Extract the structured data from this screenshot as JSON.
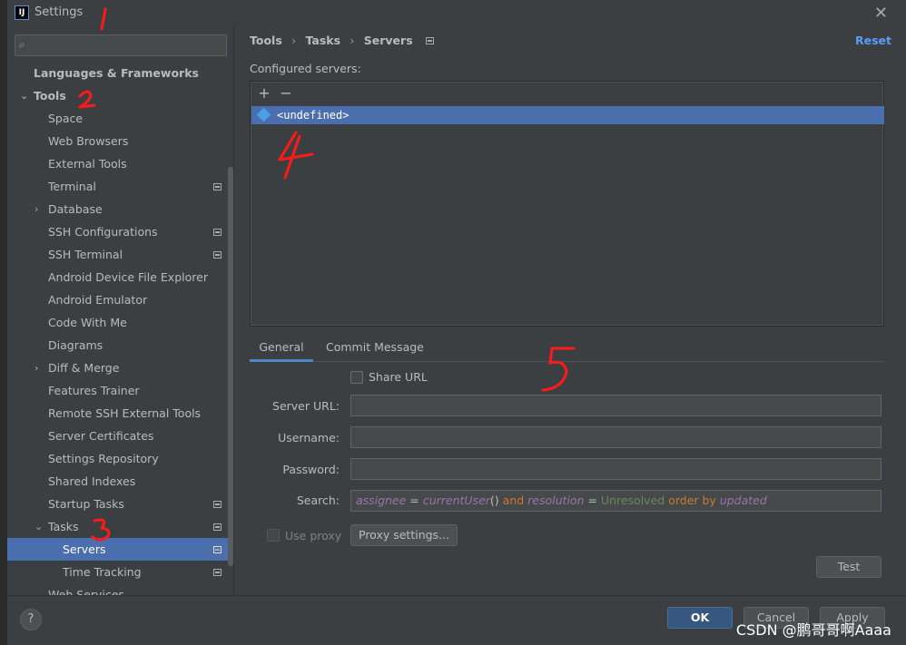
{
  "window": {
    "title": "Settings"
  },
  "sidebar": {
    "search": {
      "placeholder": "",
      "value": ""
    },
    "items": [
      {
        "label": "Languages & Frameworks"
      },
      {
        "label": "Tools"
      },
      {
        "label": "Space"
      },
      {
        "label": "Web Browsers"
      },
      {
        "label": "External Tools"
      },
      {
        "label": "Terminal"
      },
      {
        "label": "Database"
      },
      {
        "label": "SSH Configurations"
      },
      {
        "label": "SSH Terminal"
      },
      {
        "label": "Android Device File Explorer"
      },
      {
        "label": "Android Emulator"
      },
      {
        "label": "Code With Me"
      },
      {
        "label": "Diagrams"
      },
      {
        "label": "Diff & Merge"
      },
      {
        "label": "Features Trainer"
      },
      {
        "label": "Remote SSH External Tools"
      },
      {
        "label": "Server Certificates"
      },
      {
        "label": "Settings Repository"
      },
      {
        "label": "Shared Indexes"
      },
      {
        "label": "Startup Tasks"
      },
      {
        "label": "Tasks"
      },
      {
        "label": "Servers"
      },
      {
        "label": "Time Tracking"
      },
      {
        "label": "Web Services"
      }
    ]
  },
  "breadcrumb": {
    "part1": "Tools",
    "part2": "Tasks",
    "part3": "Servers",
    "sep": "›"
  },
  "reset_label": "Reset",
  "servers": {
    "label": "Configured servers:",
    "add": "+",
    "remove": "−",
    "list": [
      {
        "name": "<undefined>"
      }
    ]
  },
  "tabs": {
    "general": "General",
    "commit": "Commit Message"
  },
  "form": {
    "share_url": "Share URL",
    "server_url_label": "Server URL:",
    "username_label": "Username:",
    "password_label": "Password:",
    "search_label": "Search:",
    "query": {
      "t1": "assignee",
      "t2": " = ",
      "t3": "currentUser",
      "t4": "() ",
      "t5": "and ",
      "t6": "resolution",
      "t7": " = ",
      "t8": "Unresolved ",
      "t9": "order by ",
      "t10": "updated"
    },
    "use_proxy": "Use proxy",
    "proxy_settings": "Proxy settings...",
    "test": "Test"
  },
  "footer": {
    "help": "?",
    "ok": "OK",
    "cancel": "Cancel",
    "apply": "Apply",
    "watermark": "CSDN @鹏哥哥啊Aaaa"
  },
  "colors": {
    "accent": "#4b6eaf",
    "link": "#589df6",
    "primary": "#365880",
    "annotation": "#ff1a1a"
  }
}
